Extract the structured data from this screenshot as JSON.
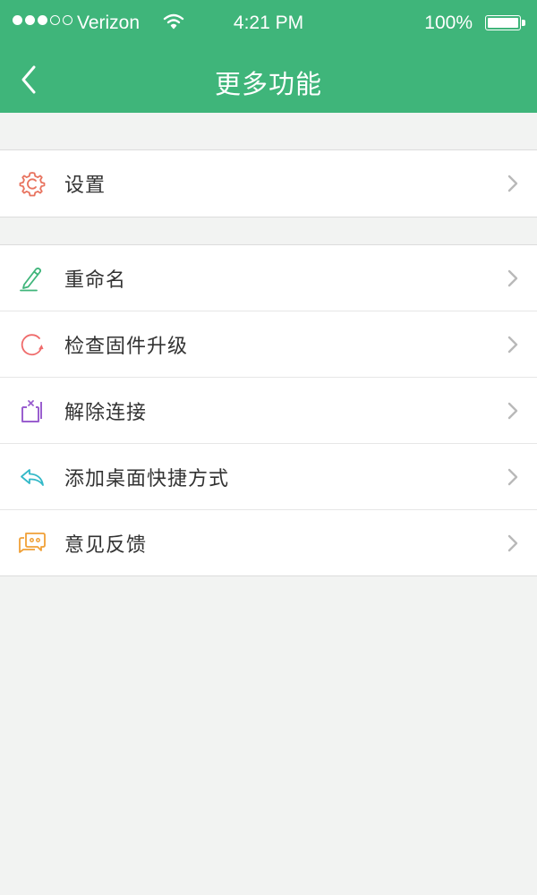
{
  "status_bar": {
    "carrier": "Verizon",
    "time": "4:21 PM",
    "battery": "100%"
  },
  "nav": {
    "title": "更多功能",
    "back_icon": "chevron-left-icon"
  },
  "groups": [
    {
      "items": [
        {
          "label": "设置",
          "icon": "gear-icon",
          "color": "#e8735f"
        }
      ]
    },
    {
      "items": [
        {
          "label": "重命名",
          "icon": "pencil-icon",
          "color": "#3fb57a"
        },
        {
          "label": "检查固件升级",
          "icon": "refresh-icon",
          "color": "#ef6b6b"
        },
        {
          "label": "解除连接",
          "icon": "disconnect-icon",
          "color": "#9a5fcf"
        },
        {
          "label": "添加桌面快捷方式",
          "icon": "reply-arrow-icon",
          "color": "#34b9c8"
        },
        {
          "label": "意见反馈",
          "icon": "chat-bubble-icon",
          "color": "#f0a037"
        }
      ]
    }
  ],
  "colors": {
    "header": "#3fb57a",
    "background": "#f2f3f2",
    "chevron": "#b9b9b9"
  }
}
